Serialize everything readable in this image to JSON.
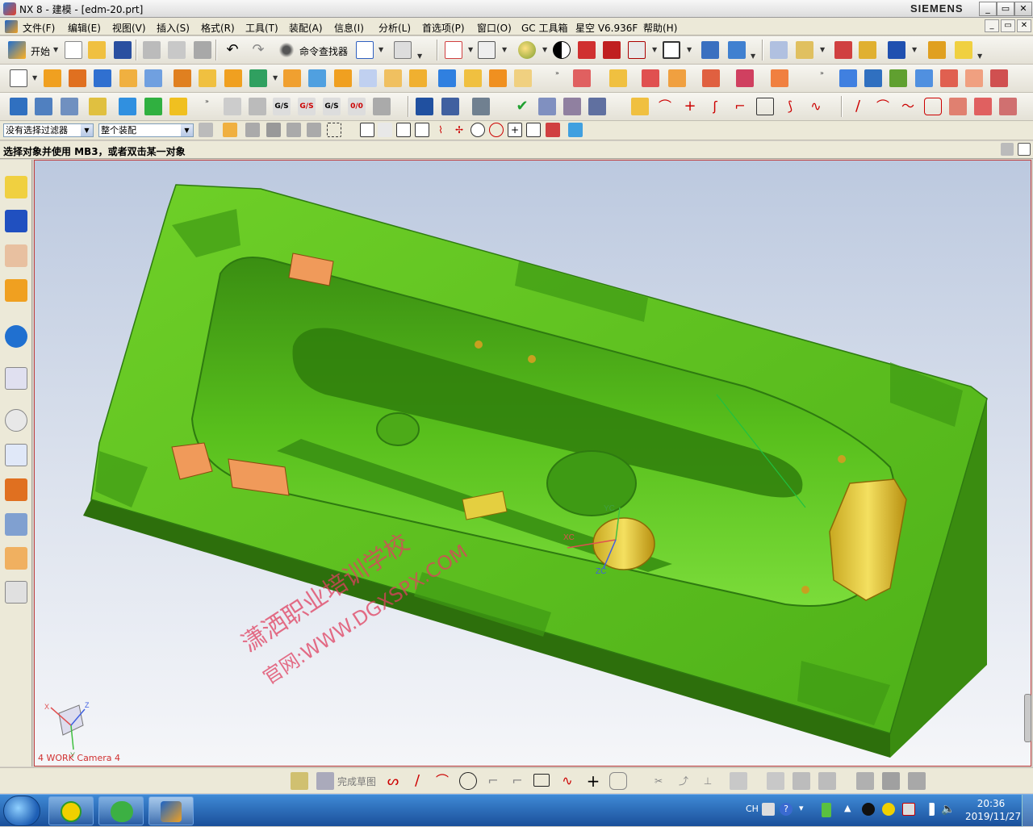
{
  "window": {
    "title": "NX 8 - 建模 - [edm-20.prt]",
    "brand": "SIEMENS",
    "controls": [
      "_",
      "▭",
      "✕"
    ]
  },
  "menu": {
    "items": [
      "文件(F)",
      "编辑(E)",
      "视图(V)",
      "插入(S)",
      "格式(R)",
      "工具(T)",
      "装配(A)",
      "信息(I)",
      "分析(L)",
      "首选项(P)",
      "窗口(O)",
      "GC 工具箱",
      "星空 V6.936F",
      "帮助(H)"
    ]
  },
  "toolbar1": {
    "start_label": "开始",
    "command_finder_label": "命令查找器"
  },
  "selection": {
    "filter": "没有选择过滤器",
    "scope": "整个装配"
  },
  "status": {
    "prompt": "选择对象并使用 MB3，或者双击某一对象"
  },
  "viewport": {
    "watermark_line1": "潇洒职业培训学校",
    "watermark_line2": "官网:WWW.DGXSPX.COM",
    "camera_label": "4 WORK Camera 4",
    "axis_labels": {
      "x": "X",
      "y": "Y",
      "z": "Z",
      "xc": "XC",
      "yc": "YC",
      "zc": "ZC"
    },
    "colors": {
      "part": "#5cc41f",
      "part_dark": "#2f7a10",
      "insert": "#e8d340",
      "electrode": "#f09a5a"
    }
  },
  "sketch_toolbar": {
    "finish_label": "完成草图"
  },
  "taskbar": {
    "tray_lang": "CH",
    "time": "20:36",
    "date": "2019/11/27"
  }
}
